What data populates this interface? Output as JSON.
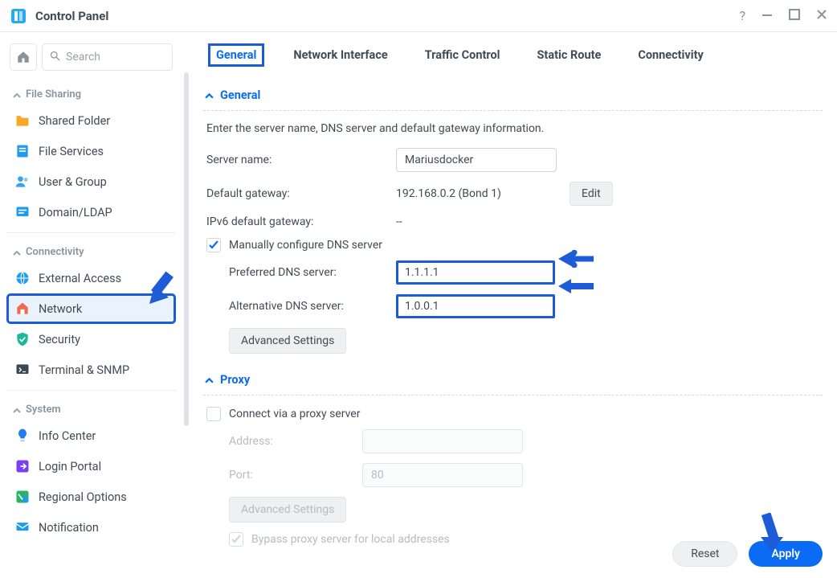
{
  "window": {
    "title": "Control Panel"
  },
  "search": {
    "placeholder": "Search"
  },
  "sidebar": {
    "groups": [
      {
        "label": "File Sharing",
        "items": [
          {
            "label": "Shared Folder"
          },
          {
            "label": "File Services"
          },
          {
            "label": "User & Group"
          },
          {
            "label": "Domain/LDAP"
          }
        ]
      },
      {
        "label": "Connectivity",
        "items": [
          {
            "label": "External Access"
          },
          {
            "label": "Network"
          },
          {
            "label": "Security"
          },
          {
            "label": "Terminal & SNMP"
          }
        ]
      },
      {
        "label": "System",
        "items": [
          {
            "label": "Info Center"
          },
          {
            "label": "Login Portal"
          },
          {
            "label": "Regional Options"
          },
          {
            "label": "Notification"
          }
        ]
      }
    ]
  },
  "tabs": [
    {
      "label": "General"
    },
    {
      "label": "Network Interface"
    },
    {
      "label": "Traffic Control"
    },
    {
      "label": "Static Route"
    },
    {
      "label": "Connectivity"
    }
  ],
  "general_section": {
    "heading": "General",
    "intro": "Enter the server name, DNS server and default gateway information.",
    "server_name_label": "Server name:",
    "server_name_value": "Mariusdocker",
    "default_gateway_label": "Default gateway:",
    "default_gateway_value": "192.168.0.2 (Bond 1)",
    "edit_label": "Edit",
    "ipv6_label": "IPv6 default gateway:",
    "ipv6_value": "--",
    "manual_dns_label": "Manually configure DNS server",
    "manual_dns_checked": true,
    "preferred_dns_label": "Preferred DNS server:",
    "preferred_dns_value": "1.1.1.1",
    "alt_dns_label": "Alternative DNS server:",
    "alt_dns_value": "1.0.0.1",
    "advanced_label": "Advanced Settings"
  },
  "proxy_section": {
    "heading": "Proxy",
    "connect_label": "Connect via a proxy server",
    "connect_checked": false,
    "address_label": "Address:",
    "address_value": "",
    "port_label": "Port:",
    "port_value": "80",
    "advanced_label": "Advanced Settings",
    "bypass_label": "Bypass proxy server for local addresses",
    "bypass_checked": true
  },
  "footer": {
    "reset_label": "Reset",
    "apply_label": "Apply"
  }
}
